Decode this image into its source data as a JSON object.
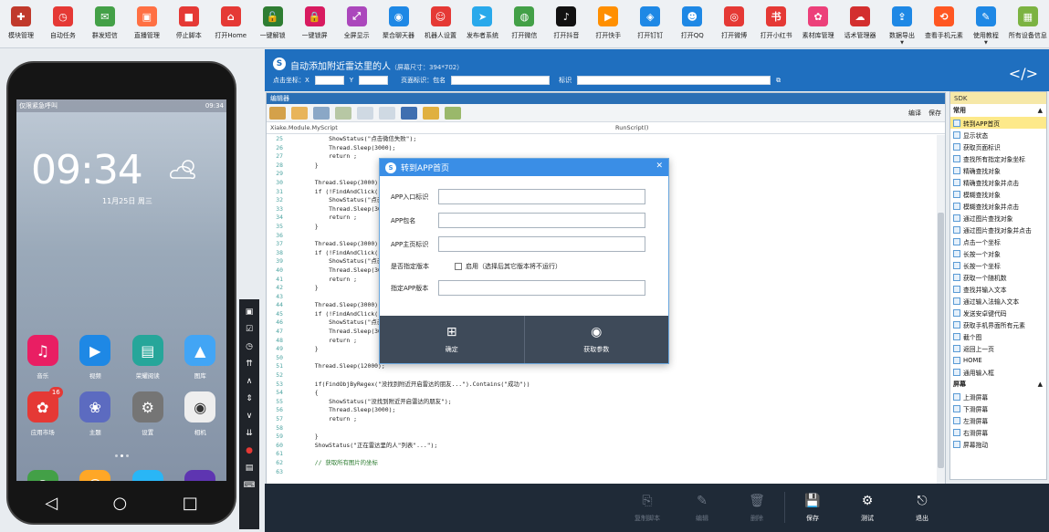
{
  "toolbar": [
    {
      "label": "模块管理",
      "icon": "module-icon",
      "color": "#c0392b",
      "glyph": "✚"
    },
    {
      "label": "自动任务",
      "icon": "clock-icon",
      "color": "#e53935",
      "glyph": "◷"
    },
    {
      "label": "群发短信",
      "icon": "sms-icon",
      "color": "#43a047",
      "glyph": "✉"
    },
    {
      "label": "直播管理",
      "icon": "tv-icon",
      "color": "#ff7043",
      "glyph": "▣"
    },
    {
      "label": "停止脚本",
      "icon": "stop-icon",
      "color": "#e53935",
      "glyph": "■"
    },
    {
      "label": "打开Home",
      "icon": "home-icon",
      "color": "#e53935",
      "glyph": "⌂"
    },
    {
      "label": "一键解锁",
      "icon": "unlock-icon",
      "color": "#2e7d32",
      "glyph": "🔓"
    },
    {
      "label": "一键锁屏",
      "icon": "lock-icon",
      "color": "#d81b60",
      "glyph": "🔒"
    },
    {
      "label": "全屏显示",
      "icon": "fullscreen-icon",
      "color": "#ab47bc",
      "glyph": "⤢"
    },
    {
      "label": "聚合聊天器",
      "icon": "chat-icon",
      "color": "#1e88e5",
      "glyph": "◉"
    },
    {
      "label": "机器人设置",
      "icon": "robot-icon",
      "color": "#e53935",
      "glyph": "☺"
    },
    {
      "label": "发布者系统",
      "icon": "telegram-icon",
      "color": "#29a9eb",
      "glyph": "➤"
    },
    {
      "label": "打开微信",
      "icon": "wechat-icon",
      "color": "#43a047",
      "glyph": "◍"
    },
    {
      "label": "打开抖音",
      "icon": "douyin-icon",
      "color": "#111111",
      "glyph": "♪"
    },
    {
      "label": "打开快手",
      "icon": "kuaishou-icon",
      "color": "#ff8f00",
      "glyph": "▶"
    },
    {
      "label": "打开钉钉",
      "icon": "dingtalk-icon",
      "color": "#1e88e5",
      "glyph": "◈"
    },
    {
      "label": "打开QQ",
      "icon": "qq-icon",
      "color": "#1e88e5",
      "glyph": "☻"
    },
    {
      "label": "打开微博",
      "icon": "weibo-icon",
      "color": "#e53935",
      "glyph": "◎"
    },
    {
      "label": "打开小红书",
      "icon": "xiaohongshu-icon",
      "color": "#e53935",
      "glyph": "书"
    },
    {
      "label": "素材库管理",
      "icon": "gallery-icon",
      "color": "#ec407a",
      "glyph": "✿"
    },
    {
      "label": "话术管理器",
      "icon": "speech-icon",
      "color": "#d32f2f",
      "glyph": "☁"
    },
    {
      "label": "数据导出",
      "icon": "export-icon",
      "color": "#1e88e5",
      "glyph": "⇪",
      "dropdown": true
    },
    {
      "label": "查看手机元素",
      "icon": "share-icon",
      "color": "#ff5722",
      "glyph": "⟲"
    },
    {
      "label": "使用教程",
      "icon": "tutorial-icon",
      "color": "#1e88e5",
      "glyph": "✎",
      "dropdown": true
    },
    {
      "label": "所有设备信息",
      "icon": "devices-icon",
      "color": "#7cb342",
      "glyph": "▦"
    }
  ],
  "phone": {
    "status_left": "仅限紧急呼叫",
    "status_right": "09:34",
    "clock": "09:34",
    "date": "11月25日  周三",
    "apps_row1": [
      {
        "name": "音乐",
        "color": "#e91e63",
        "glyph": "♫"
      },
      {
        "name": "视频",
        "color": "#1e88e5",
        "glyph": "▶"
      },
      {
        "name": "荣耀阅读",
        "color": "#26a69a",
        "glyph": "▤"
      },
      {
        "name": "图库",
        "color": "#42a5f5",
        "glyph": "▲"
      }
    ],
    "apps_row2": [
      {
        "name": "应用市场",
        "color": "#e53935",
        "glyph": "✿",
        "badge": "16"
      },
      {
        "name": "主题",
        "color": "#5c6bc0",
        "glyph": "❀"
      },
      {
        "name": "设置",
        "color": "#757575",
        "glyph": "⚙"
      },
      {
        "name": "相机",
        "color": "#eeeeee",
        "glyph": "◉"
      }
    ],
    "dock": [
      {
        "name": "phone",
        "color": "#43a047",
        "glyph": "✆"
      },
      {
        "name": "contacts",
        "color": "#ffa726",
        "glyph": "☺"
      },
      {
        "name": "messages",
        "color": "#29b6f6",
        "glyph": "✉"
      },
      {
        "name": "browser",
        "color": "#5e35b1",
        "glyph": "◍"
      }
    ]
  },
  "header": {
    "title": "自动添加附近雷达里的人",
    "screen_size": "（屏幕尺寸：394*702）",
    "click_label": "点击坐标：X",
    "y_label": "Y",
    "page_label": "页面标识：包名",
    "id_label": "标识"
  },
  "editor": {
    "title": "编辑器",
    "compile": "编译",
    "save": "保存",
    "class_path": "Xiake.Module.MyScript",
    "method_path": "RunScript()",
    "lines": [
      {
        "n": "25",
        "t": "            ShowStatus(\"点击微信失败\");"
      },
      {
        "n": "26",
        "t": "            Thread.Sleep(3000);"
      },
      {
        "n": "27",
        "t": "            return ;"
      },
      {
        "n": "28",
        "t": "        }"
      },
      {
        "n": "29",
        "t": ""
      },
      {
        "n": "30",
        "t": "        Thread.Sleep(3000);"
      },
      {
        "n": "31",
        "t": "        if (!FindAndClick(\"发现\"))"
      },
      {
        "n": "32",
        "t": "            ShowStatus(\"点击发现失败\");"
      },
      {
        "n": "33",
        "t": "            Thread.Sleep(3000);"
      },
      {
        "n": "34",
        "t": "            return ;"
      },
      {
        "n": "35",
        "t": "        }"
      },
      {
        "n": "36",
        "t": ""
      },
      {
        "n": "37",
        "t": "        Thread.Sleep(3000);"
      },
      {
        "n": "38",
        "t": "        if (!FindAndClick(\"附近\"))"
      },
      {
        "n": "39",
        "t": "            ShowStatus(\"点击附近失败\");"
      },
      {
        "n": "40",
        "t": "            Thread.Sleep(3000);"
      },
      {
        "n": "41",
        "t": "            return ;"
      },
      {
        "n": "42",
        "t": "        }"
      },
      {
        "n": "43",
        "t": ""
      },
      {
        "n": "44",
        "t": "        Thread.Sleep(3000);"
      },
      {
        "n": "45",
        "t": "        if (!FindAndClick(\"雷达\"))"
      },
      {
        "n": "46",
        "t": "            ShowStatus(\"点击雷达失败\");"
      },
      {
        "n": "47",
        "t": "            Thread.Sleep(3000);"
      },
      {
        "n": "48",
        "t": "            return ;"
      },
      {
        "n": "49",
        "t": "        }"
      },
      {
        "n": "50",
        "t": ""
      },
      {
        "n": "51",
        "t": "        Thread.Sleep(12000);"
      },
      {
        "n": "52",
        "t": ""
      },
      {
        "n": "53",
        "t": "        if(FindObjByRegex(\"没找到附近开启雷达的朋友...\").Contains(\"成功\"))"
      },
      {
        "n": "54",
        "t": "        {"
      },
      {
        "n": "55",
        "t": "            ShowStatus(\"没找到附近开启雷达的朋友\");"
      },
      {
        "n": "56",
        "t": "            Thread.Sleep(3000);"
      },
      {
        "n": "57",
        "t": "            return ;"
      },
      {
        "n": "58",
        "t": ""
      },
      {
        "n": "59",
        "t": "        }"
      },
      {
        "n": "60",
        "t": "        ShowStatus(\"正在雷达里的人\"列表\"...\");"
      },
      {
        "n": "61",
        "t": ""
      },
      {
        "n": "62",
        "t": "        // 获取所有图片的坐标"
      },
      {
        "n": "63",
        "t": ""
      }
    ]
  },
  "dialog": {
    "title": "转到APP首页",
    "f1": "APP入口标识",
    "f2": "APP包名",
    "f3": "APP主页标识",
    "f4": "是否指定版本",
    "enable": "启用（选择后其它版本将不运行）",
    "f5": "指定APP版本",
    "ok": "确定",
    "params": "获取参数"
  },
  "rightpanel": {
    "header": "SDK",
    "sec1": "常用",
    "items1": [
      "转到APP首页",
      "显示状态",
      "获取页面标识",
      "查找所有指定对象坐标",
      "精确查找对象",
      "精确查找对象并点击",
      "模糊查找对象",
      "模糊查找对象并点击",
      "通过图片查找对象",
      "通过图片查找对象并点击",
      "点击一个坐标",
      "长按一个对象",
      "长按一个坐标",
      "获取一个随机数",
      "查找并输入文本",
      "通过输入法输入文本",
      "发送安卓键代码",
      "获取手机界面所有元素",
      "截个图",
      "返回上一页",
      "HOME",
      "通用输入框"
    ],
    "sec2": "屏幕",
    "items2": [
      "上滑屏幕",
      "下滑屏幕",
      "左滑屏幕",
      "右滑屏幕",
      "屏幕拖动"
    ]
  },
  "bottombar": {
    "copy": "复制脚本",
    "edit": "编辑",
    "delete": "删除",
    "save": "保存",
    "test": "测试",
    "exit": "退出"
  }
}
